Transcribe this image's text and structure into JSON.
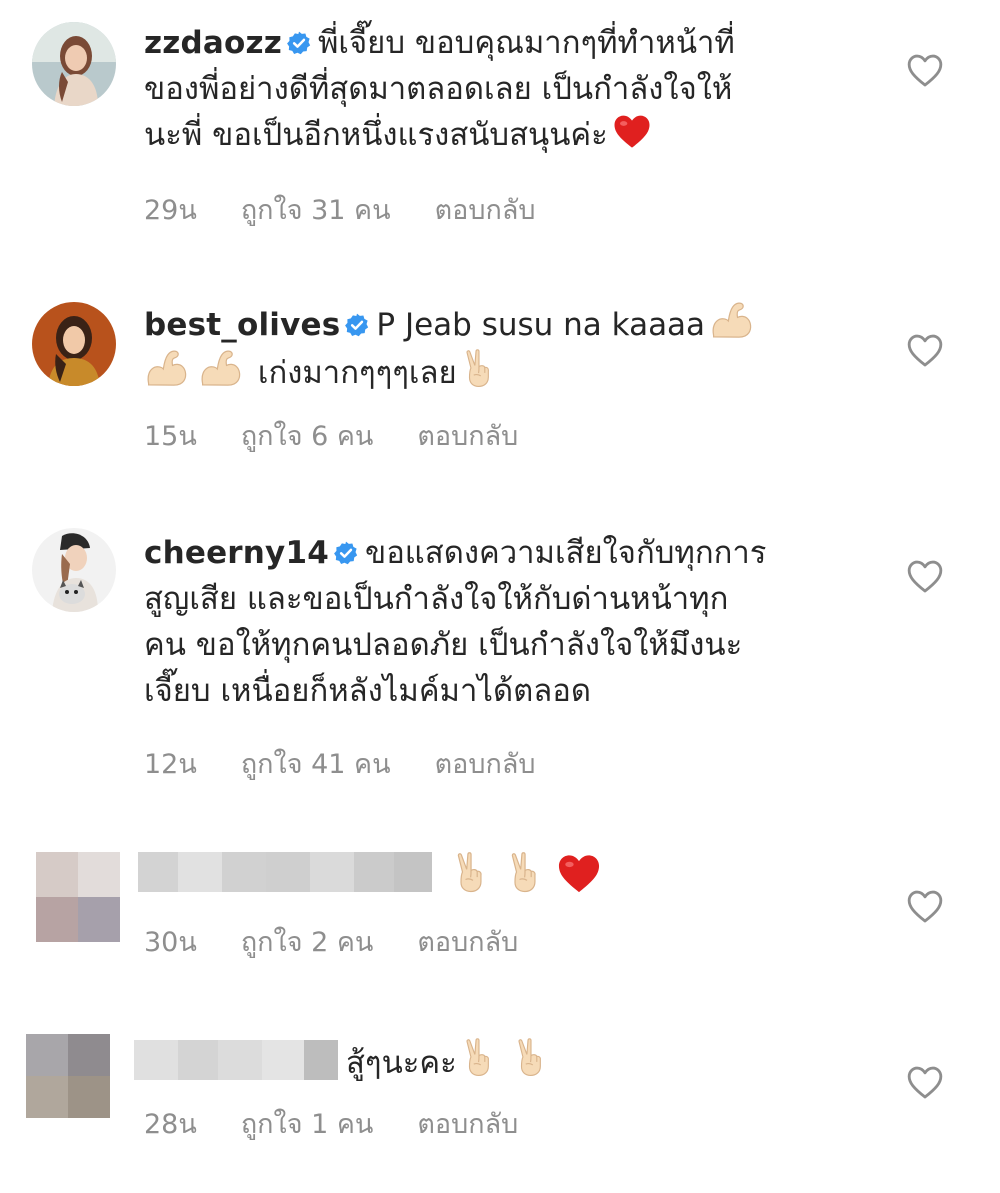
{
  "comments": [
    {
      "username": "zzdaozz",
      "verified": true,
      "avatar": "avatar-woman-outdoor",
      "lines": [
        "พี่เจี๊ยบ ขอบคุณมากๆที่ทำหน้าที่",
        "ของพี่อย่างดีที่สุดมาตลอดเลย เป็นกำลังใจให้",
        "นะพี่ ขอเป็นอีกหนึ่งแรงสนับสนุนค่ะ"
      ],
      "time": "29น",
      "likes": "ถูกใจ 31 คน",
      "reply": "ตอบกลับ"
    },
    {
      "username": "best_olives",
      "verified": true,
      "avatar": "avatar-woman-orange-bg",
      "text_line1": "P Jeab susu na kaaaa",
      "text_line2": "เก่งมากๆๆๆเลย",
      "time": "15น",
      "likes": "ถูกใจ 6 คน",
      "reply": "ตอบกลับ"
    },
    {
      "username": "cheerny14",
      "verified": true,
      "avatar": "avatar-woman-with-dog",
      "lines": [
        "ขอแสดงความเสียใจกับทุกการ",
        "สูญเสีย และขอเป็นกำลังใจให้กับด่านหน้าทุก",
        "คน ขอให้ทุกคนปลอดภัย เป็นกำลังใจให้มึงนะ",
        "เจี๊ยบ เหนื่อยก็หลังไมค์มาได้ตลอด"
      ],
      "time": "12น",
      "likes": "ถูกใจ 41 คน",
      "reply": "ตอบกลับ"
    },
    {
      "username": "",
      "avatar": "avatar-blurred",
      "emojis": [
        "victory-hand-icon",
        "victory-hand-icon",
        "red-heart-icon"
      ],
      "time": "30น",
      "likes": "ถูกใจ 2 คน",
      "reply": "ตอบกลับ"
    },
    {
      "username": "",
      "avatar": "avatar-blurred",
      "text": "สู้ๆนะคะ",
      "emojis": [
        "victory-hand-icon",
        "victory-hand-icon"
      ],
      "time": "28น",
      "likes": "ถูกใจ 1 คน",
      "reply": "ตอบกลับ"
    }
  ],
  "colors": {
    "text": "#262626",
    "meta": "#8e8e8e",
    "verified": "#3897f0",
    "heart": "#e0201f"
  }
}
